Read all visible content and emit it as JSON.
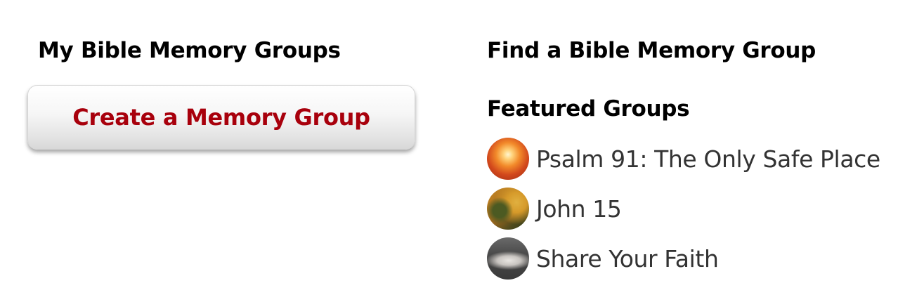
{
  "my_groups": {
    "heading": "My Bible Memory Groups",
    "create_button_label": "Create a Memory Group"
  },
  "find_groups": {
    "heading": "Find a Bible Memory Group",
    "featured_heading": "Featured Groups",
    "featured": [
      {
        "name": "Psalm 91: The Only Safe Place",
        "icon": "sunlight-thumbnail-icon"
      },
      {
        "name": "John 15",
        "icon": "vine-thumbnail-icon"
      },
      {
        "name": "Share Your Faith",
        "icon": "open-book-thumbnail-icon"
      }
    ]
  },
  "colors": {
    "button_text": "#a8000c",
    "heading_text": "#000000",
    "link_text": "#333333"
  }
}
